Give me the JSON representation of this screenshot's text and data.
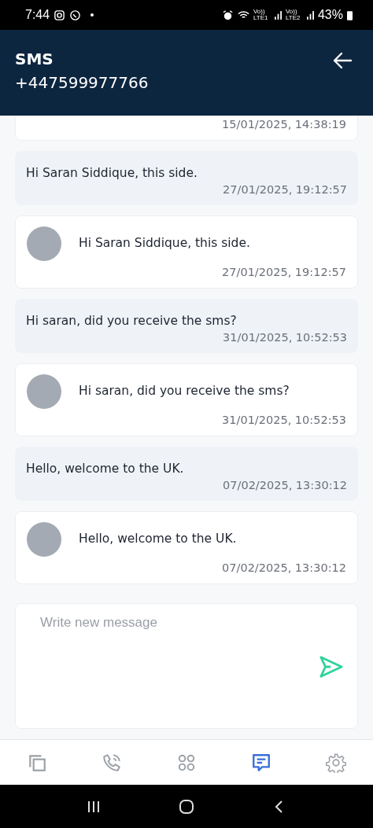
{
  "status_bar": {
    "time": "7:44",
    "network_1": "Vo)) LTE1",
    "network_2": "Vo)) LTE2",
    "battery": "43%"
  },
  "header": {
    "title": "SMS",
    "subtitle": "+447599977766"
  },
  "messages": [
    {
      "kind": "outgoing",
      "time": "15/01/2025, 14:38:19"
    },
    {
      "kind": "incoming",
      "text": "Hi Saran Siddique, this side.",
      "time": "27/01/2025, 19:12:57"
    },
    {
      "kind": "outgoing",
      "text": "Hi Saran Siddique, this side.",
      "time": "27/01/2025, 19:12:57"
    },
    {
      "kind": "incoming",
      "text": "Hi saran, did you receive the sms?",
      "time": "31/01/2025, 10:52:53"
    },
    {
      "kind": "outgoing",
      "text": "Hi saran, did you receive the sms?",
      "time": "31/01/2025, 10:52:53"
    },
    {
      "kind": "incoming",
      "text": "Hello, welcome to the UK.",
      "time": "07/02/2025, 13:30:12"
    },
    {
      "kind": "outgoing",
      "text": "Hello, welcome to the UK.",
      "time": "07/02/2025, 13:30:12"
    }
  ],
  "composer": {
    "placeholder": "Write new message"
  },
  "nav_tabs": [
    {
      "kind": "copy",
      "selected": false
    },
    {
      "kind": "phone",
      "selected": false
    },
    {
      "kind": "apps",
      "selected": false
    },
    {
      "kind": "chat",
      "selected": true
    },
    {
      "kind": "settings",
      "selected": false
    }
  ]
}
